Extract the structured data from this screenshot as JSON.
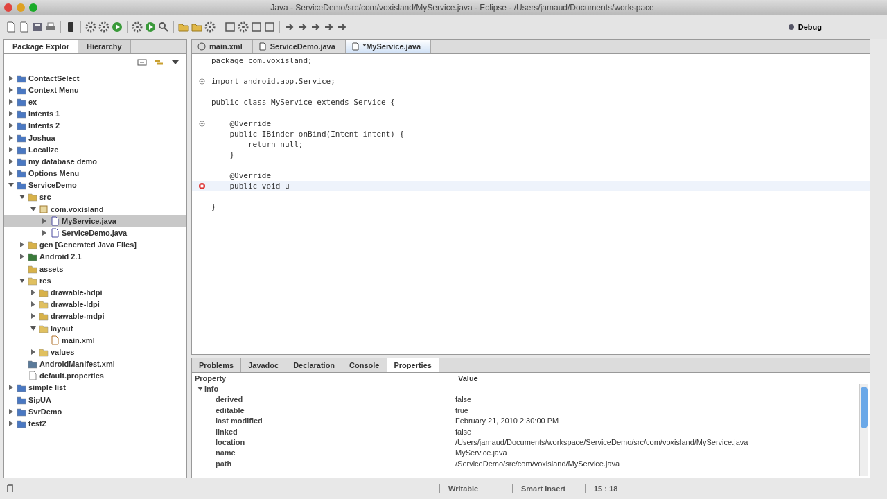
{
  "window": {
    "title": "Java - ServiceDemo/src/com/voxisland/MyService.java - Eclipse - /Users/jamaud/Documents/workspace"
  },
  "perspective": {
    "label": "Debug"
  },
  "explorer": {
    "tabs": [
      {
        "label": "Package Explor",
        "selected": true
      },
      {
        "label": "Hierarchy",
        "selected": false
      }
    ],
    "tree": [
      {
        "label": "ContactSelect",
        "kind": "project",
        "expanded": false,
        "selected": false
      },
      {
        "label": "Context Menu",
        "kind": "project",
        "expanded": false,
        "selected": false
      },
      {
        "label": "ex",
        "kind": "project",
        "expanded": false,
        "selected": false
      },
      {
        "label": "Intents 1",
        "kind": "project",
        "expanded": false,
        "selected": false
      },
      {
        "label": "Intents 2",
        "kind": "project",
        "expanded": false,
        "selected": false
      },
      {
        "label": "Joshua",
        "kind": "project",
        "expanded": false,
        "selected": false
      },
      {
        "label": "Localize",
        "kind": "project",
        "expanded": false,
        "selected": false
      },
      {
        "label": "my database demo",
        "kind": "project",
        "expanded": false,
        "selected": false
      },
      {
        "label": "Options Menu",
        "kind": "project",
        "expanded": false,
        "selected": false
      },
      {
        "label": "ServiceDemo",
        "kind": "project",
        "expanded": true,
        "selected": false,
        "children": [
          {
            "label": "src",
            "kind": "source-folder",
            "expanded": true,
            "selected": false,
            "children": [
              {
                "label": "com.voxisland",
                "kind": "package",
                "expanded": true,
                "selected": false,
                "children": [
                  {
                    "label": "MyService.java",
                    "kind": "java-file",
                    "expanded": false,
                    "selected": true
                  },
                  {
                    "label": "ServiceDemo.java",
                    "kind": "java-file",
                    "expanded": false,
                    "selected": false
                  }
                ]
              }
            ]
          },
          {
            "label": "gen [Generated Java Files]",
            "kind": "source-folder",
            "expanded": false,
            "selected": false
          },
          {
            "label": "Android 2.1",
            "kind": "library",
            "expanded": false,
            "selected": false
          },
          {
            "label": "assets",
            "kind": "source-folder",
            "selected": false
          },
          {
            "label": "res",
            "kind": "folder",
            "expanded": true,
            "selected": false,
            "children": [
              {
                "label": "drawable-hdpi",
                "kind": "source-folder",
                "expanded": false,
                "selected": false
              },
              {
                "label": "drawable-ldpi",
                "kind": "folder",
                "expanded": false,
                "selected": false
              },
              {
                "label": "drawable-mdpi",
                "kind": "source-folder",
                "expanded": false,
                "selected": false
              },
              {
                "label": "layout",
                "kind": "folder",
                "expanded": true,
                "selected": false,
                "children": [
                  {
                    "label": "main.xml",
                    "kind": "xml-file",
                    "selected": false
                  }
                ]
              },
              {
                "label": "values",
                "kind": "folder",
                "expanded": false,
                "selected": false
              }
            ]
          },
          {
            "label": "AndroidManifest.xml",
            "kind": "manifest",
            "selected": false
          },
          {
            "label": "default.properties",
            "kind": "file",
            "selected": false
          }
        ]
      },
      {
        "label": "simple list",
        "kind": "project",
        "expanded": false,
        "selected": false
      },
      {
        "label": "SipUA",
        "kind": "project",
        "selected": false
      },
      {
        "label": "SvrDemo",
        "kind": "project",
        "expanded": false,
        "selected": false
      },
      {
        "label": "test2",
        "kind": "project",
        "expanded": false,
        "selected": false
      }
    ]
  },
  "editor": {
    "tabs": [
      {
        "label": "main.xml",
        "kind": "xml",
        "selected": false
      },
      {
        "label": "ServiceDemo.java",
        "kind": "java",
        "selected": false
      },
      {
        "label": "*MyService.java",
        "kind": "java",
        "selected": true
      }
    ],
    "lines": [
      {
        "text": "package com.voxisland;",
        "fold": false,
        "error": false,
        "current": false
      },
      {
        "fold": false,
        "error": false,
        "current": false
      },
      {
        "text": "import android.app.Service;",
        "fold": true,
        "error": false,
        "current": false
      },
      {
        "fold": false,
        "error": false,
        "current": false
      },
      {
        "text": "public class MyService extends Service {",
        "fold": false,
        "error": false,
        "current": false
      },
      {
        "fold": false,
        "error": false,
        "current": false
      },
      {
        "text": "    @Override",
        "fold": true,
        "error": false,
        "current": false
      },
      {
        "text": "    public IBinder onBind(Intent intent) {",
        "fold": false,
        "error": false,
        "current": false
      },
      {
        "text": "        return null;",
        "fold": false,
        "error": false,
        "current": false
      },
      {
        "text": "    }",
        "fold": false,
        "error": false,
        "current": false
      },
      {
        "fold": false,
        "error": false,
        "current": false
      },
      {
        "text": "    @Override",
        "fold": false,
        "error": false,
        "current": false
      },
      {
        "text": "    public void u",
        "fold": false,
        "error": true,
        "current": true
      },
      {
        "fold": false,
        "error": false,
        "current": false
      },
      {
        "text": "}",
        "fold": false,
        "error": false,
        "current": false
      }
    ]
  },
  "bottom": {
    "tabs": [
      {
        "label": "Problems",
        "selected": false
      },
      {
        "label": "Javadoc",
        "selected": false
      },
      {
        "label": "Declaration",
        "selected": false
      },
      {
        "label": "Console",
        "selected": false
      },
      {
        "label": "Properties",
        "selected": true
      }
    ],
    "columns": [
      "Property",
      "Value"
    ],
    "group": {
      "label": "Info",
      "expanded": true
    },
    "rows": [
      {
        "property": "derived",
        "value": "false"
      },
      {
        "property": "editable",
        "value": "true"
      },
      {
        "property": "last modified",
        "value": "February 21, 2010 2:30:00 PM"
      },
      {
        "property": "linked",
        "value": "false"
      },
      {
        "property": "location",
        "value": "/Users/jamaud/Documents/workspace/ServiceDemo/src/com/voxisland/MyService.java"
      },
      {
        "property": "name",
        "value": "MyService.java"
      },
      {
        "property": "path",
        "value": "/ServiceDemo/src/com/voxisland/MyService.java"
      }
    ]
  },
  "status_bar": {
    "fields": [
      "Writable",
      "Smart Insert",
      "15 : 18"
    ]
  }
}
